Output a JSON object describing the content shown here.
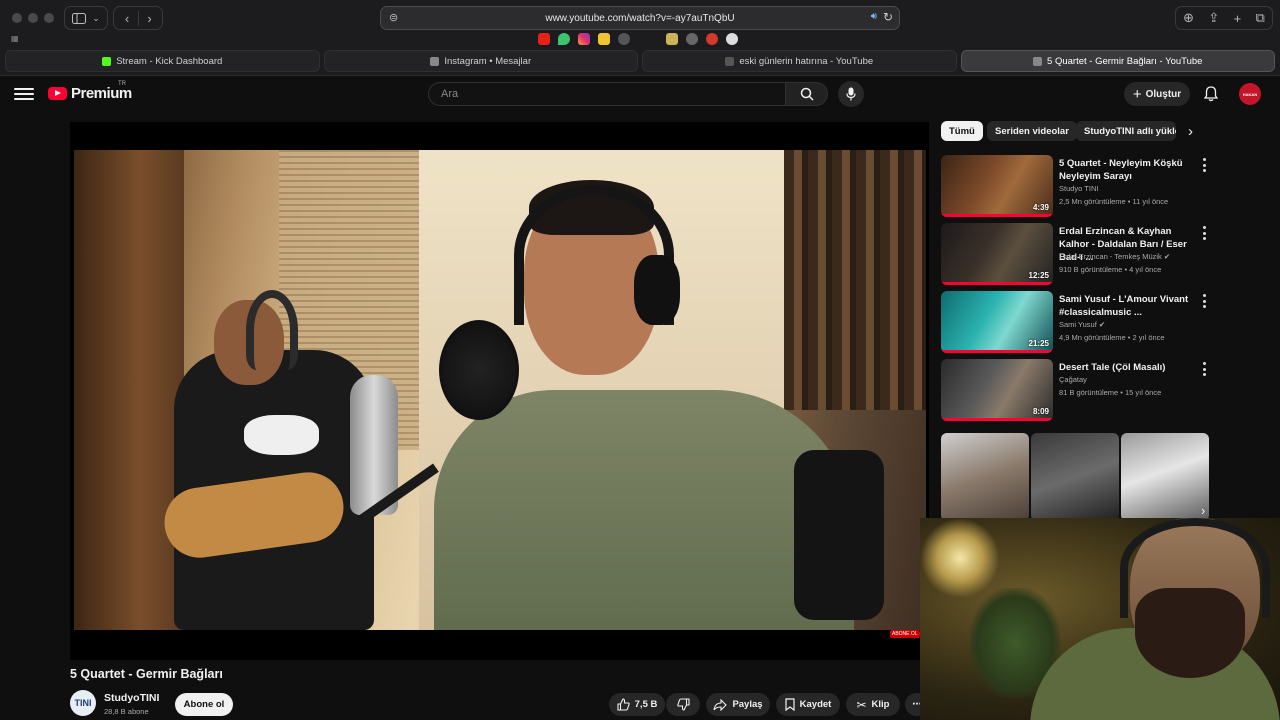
{
  "browser": {
    "url": "www.youtube.com/watch?v=-ay7auTnQbU",
    "tabs": [
      {
        "label": "Stream - Kick Dashboard",
        "active": false
      },
      {
        "label": "Instagram • Mesajlar",
        "active": false
      },
      {
        "label": "eski günlerin hatırına - YouTube",
        "active": false
      },
      {
        "label": "5 Quartet - Germir Bağları - YouTube",
        "active": true
      }
    ]
  },
  "youtube": {
    "logo_text": "Premium",
    "logo_region": "TR",
    "search_placeholder": "Ara",
    "create_label": "Oluştur",
    "avatar_text": "HAKAN"
  },
  "video": {
    "title": "5 Quartet - Germir Bağları",
    "overlay_badge": "ABONE OL",
    "channel": {
      "name": "StudyoTINI",
      "subs": "28,8 B abone",
      "avatar_text": "TINI"
    },
    "subscribe_label": "Abone ol",
    "actions": {
      "likes": "7,5 B",
      "share": "Paylaş",
      "save": "Kaydet",
      "clip": "Klip"
    }
  },
  "sidebar": {
    "chips": [
      "Tümü",
      "Seriden videolar",
      "StudyoTINI adlı yükle"
    ],
    "recommendations": [
      {
        "title": "5 Quartet - Neyleyim Köşkü Neyleyim Sarayı",
        "channel": "Studyo TINI",
        "meta": "2,5 Mn görüntüleme • 11 yıl önce",
        "duration": "4:39"
      },
      {
        "title": "Erdal Erzincan & Kayhan Kalhor - Daldalan Barı / Eser Bad-ı ...",
        "channel": "Erdal Erzincan - Temkeş Müzik",
        "meta": "910 B görüntüleme • 4 yıl önce",
        "duration": "12:25"
      },
      {
        "title": "Sami Yusuf - L'Amour Vivant #classicalmusic ...",
        "channel": "Sami Yusuf",
        "meta": "4,9 Mn görüntüleme • 2 yıl önce",
        "duration": "21:25"
      },
      {
        "title": "Desert Tale (Çöl Masalı)",
        "channel": "Çağatay",
        "meta": "81 B görüntüleme • 15 yıl önce",
        "duration": "8:09"
      }
    ]
  }
}
